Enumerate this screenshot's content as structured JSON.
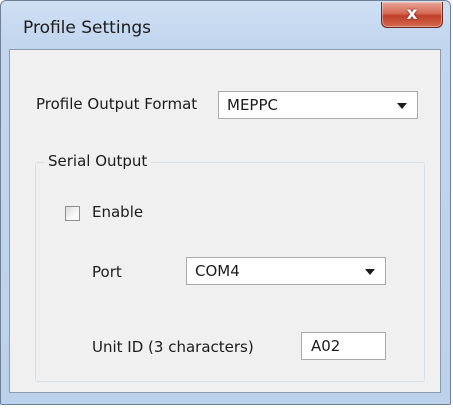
{
  "window": {
    "title": "Profile Settings",
    "close_label": "x"
  },
  "profile_output_format": {
    "label": "Profile Output Format",
    "selected": "MEPPC"
  },
  "serial_output": {
    "group_title": "Serial Output",
    "enable": {
      "label": "Enable",
      "checked": false
    },
    "port": {
      "label": "Port",
      "selected": "COM4"
    },
    "unit_id": {
      "label": "Unit ID (3 characters)",
      "value": "A02"
    }
  },
  "colors": {
    "title_bar": "#c2d6ee",
    "close_button": "#c0402a",
    "client_background": "#f0f0f0"
  }
}
